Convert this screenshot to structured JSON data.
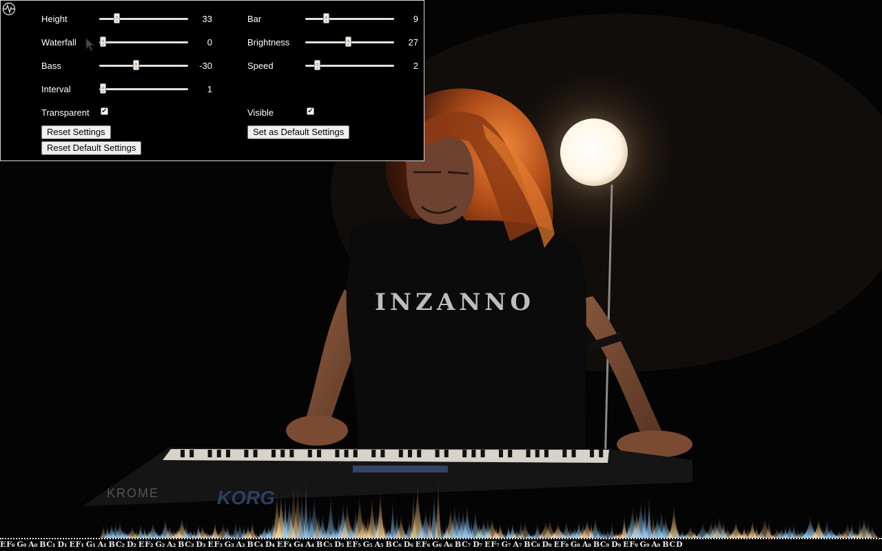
{
  "settings": {
    "sliders": [
      {
        "id": "height",
        "label": "Height",
        "value": "33",
        "fraction": 0.19,
        "column": "left",
        "row": 0
      },
      {
        "id": "bar",
        "label": "Bar",
        "value": "9",
        "fraction": 0.23,
        "column": "right",
        "row": 0
      },
      {
        "id": "waterfall",
        "label": "Waterfall",
        "value": "0",
        "fraction": 0.04,
        "column": "left",
        "row": 1
      },
      {
        "id": "brightness",
        "label": "Brightness",
        "value": "27",
        "fraction": 0.48,
        "column": "right",
        "row": 1
      },
      {
        "id": "bass",
        "label": "Bass",
        "value": "-30",
        "fraction": 0.41,
        "column": "left",
        "row": 2
      },
      {
        "id": "speed",
        "label": "Speed",
        "value": "2",
        "fraction": 0.13,
        "column": "right",
        "row": 2
      },
      {
        "id": "interval",
        "label": "Interval",
        "value": "1",
        "fraction": 0.04,
        "column": "left",
        "row": 3
      }
    ],
    "checkboxes": {
      "transparent": {
        "label": "Transparent",
        "checked": true
      },
      "visible": {
        "label": "Visible",
        "checked": true
      }
    },
    "buttons": {
      "reset_settings": "Reset Settings",
      "set_default": "Set as Default Settings",
      "reset_default": "Reset Default Settings"
    }
  },
  "video": {
    "shirt_text": "INZANNO",
    "keyboard_brand": "KORG",
    "keyboard_model": "KROME"
  },
  "notes_bar": {
    "labels": [
      "E",
      "F₀",
      "G₀",
      "A₀",
      "B",
      "C₁",
      "D₁",
      "E",
      "F₁",
      "G₁",
      "A₁",
      "B",
      "C₂",
      "D₂",
      "E",
      "F₂",
      "G₂",
      "A₂",
      "B",
      "C₃",
      "D₃",
      "E",
      "F₃",
      "G₃",
      "A₃",
      "B",
      "C₄",
      "D₄",
      "E",
      "F₄",
      "G₄",
      "A₄",
      "B",
      "C₅",
      "D₅",
      "E",
      "F₅",
      "G₅",
      "A₅",
      "B",
      "C₆",
      "D₆",
      "E",
      "F₆",
      "G₆",
      "A₆",
      "B",
      "C₇",
      "D₇",
      "E",
      "F₇",
      "G₇",
      "A₇",
      "B",
      "C₈",
      "D₈",
      "E",
      "F₈",
      "G₈",
      "A₈",
      "B",
      "C₉",
      "D₉",
      "E",
      "F₉",
      "G₉",
      "A₉",
      "B",
      "C",
      "D"
    ]
  },
  "icons": {
    "app": "waveform-icon",
    "cursor": "mouse-pointer-icon"
  },
  "colors": {
    "panel_bg": "#000000",
    "panel_border": "#d8d8d8",
    "lamp": "#fffaf0",
    "hair_glow": "#d7651f",
    "spectrum_blue": "#6fb4e8",
    "spectrum_gold": "#e8b060"
  }
}
